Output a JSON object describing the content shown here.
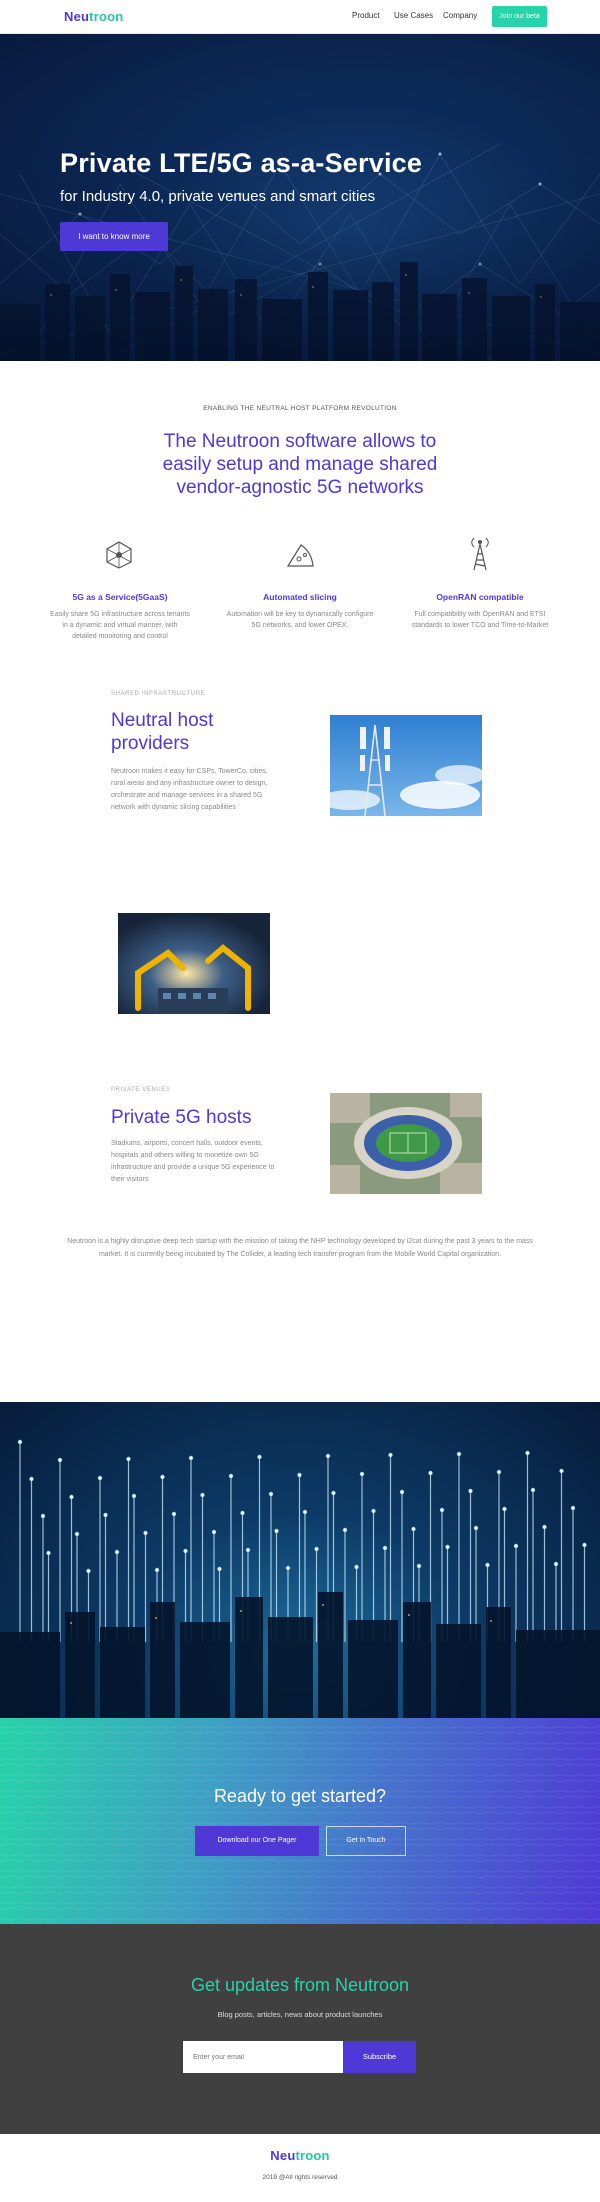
{
  "header": {
    "logo": {
      "part1": "Neu",
      "part2": "troon"
    },
    "nav": [
      "Product",
      "Use Cases",
      "Company"
    ],
    "cta": "Join our beta"
  },
  "hero": {
    "title": "Private LTE/5G as-a-Service",
    "subtitle": "for Industry 4.0, private venues and smart cities",
    "button": "I want to know more"
  },
  "intro": {
    "eyebrow": "ENABLING THE NEUTRAL HOST PLATFORM REVOLUTION",
    "heading": "The Neutroon software allows to easily setup and manage shared vendor-agnostic 5G networks"
  },
  "features": [
    {
      "icon": "network-hex-icon",
      "title": "5G as a Service(5GaaS)",
      "desc": "Easily share 5G infrastructure across tenants in a dynamic and virtual manner, with detailed monitoring and control"
    },
    {
      "icon": "pizza-slice-icon",
      "title": "Automated slicing",
      "desc": "Automation will be key to dynamically configure 5G networks, and lower OPEX."
    },
    {
      "icon": "antenna-tower-icon",
      "title": "OpenRAN compatible",
      "desc": "Full compatibility with OpenRAN and ETSI standards to lower TCO and Time-to-Market"
    }
  ],
  "sections": {
    "shared": {
      "eyebrow": "SHARED INFRASTRUCTURE",
      "heading": "Neutral host providers",
      "text": "Neutroon makes it easy for CSPs, TowerCo, cities, rural areas and any infrastructure owner to design, orchestrate and manage services in a shared 5G network with dynamic slicing capabilities"
    },
    "venues": {
      "eyebrow": "PRIVATE VENUES",
      "heading": "Private 5G hosts",
      "text": "Stadiums, airports, concert halls, outdoor events, hospitals and others willing to monetize own 5G infrastructure and provide a unique 5G experience to their visitors"
    }
  },
  "about": "Neutroon is a highly disruptive deep tech startup with the mission of taking the NHP technology developed by i2cat during the past 3 years to the mass market. It is currently being incubated by The Collider, a leading tech transfer program from the Mobile World Capital organization.",
  "cta": {
    "title": "Ready to get started?",
    "primary": "Download our One Pager",
    "secondary": "Get in Touch"
  },
  "updates": {
    "title": "Get updates from Neutroon",
    "subtitle": "Blog posts, articles, news about product launches",
    "placeholder": "Enter your email",
    "button": "Subscribe"
  },
  "footer": {
    "copyright": "2019 @All rights reserved"
  },
  "colors": {
    "primary": "#4f39d6",
    "accent": "#27d3a9",
    "dark": "#404040"
  }
}
